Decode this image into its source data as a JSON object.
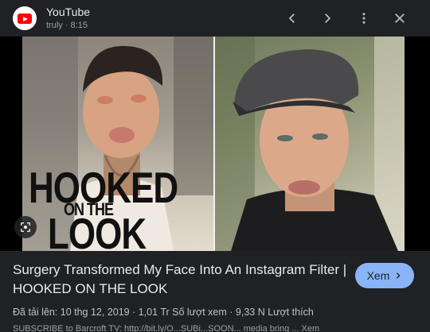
{
  "header": {
    "app_name": "YouTube",
    "source": "truly · 8:15",
    "icon": "youtube-icon"
  },
  "media": {
    "overlay_line1": "HOOKED",
    "overlay_line2": "ON THE",
    "overlay_line3": "LOOK",
    "lens_icon": "google-lens-icon"
  },
  "result": {
    "title": "Surgery Transformed My Face Into An Instagram Filter | HOOKED ON THE LOOK",
    "view_button_label": "Xem",
    "meta": "Đã tải lên: 10 thg 12, 2019  ·  1,01 Tr Số lượt xem  ·  9,33 N Lượt thích",
    "description": "SUBSCRIBE to Barcroft TV: http://bit.ly/O...SUBi...SOON... media bring ... Xem"
  },
  "colors": {
    "background": "#202124",
    "accent": "#8ab4f8",
    "brand": "#ff0000"
  }
}
